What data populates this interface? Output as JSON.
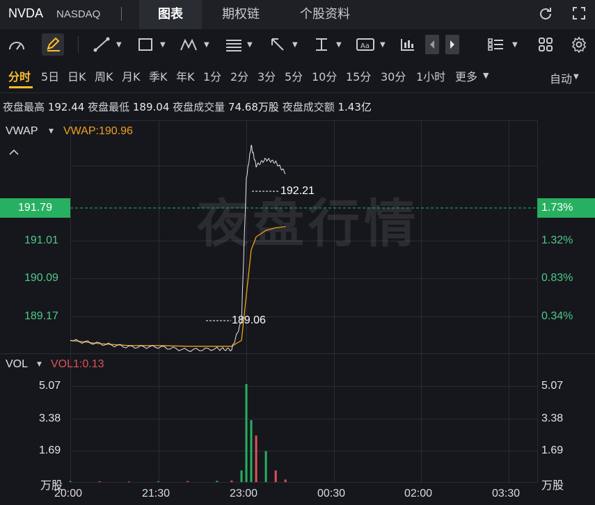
{
  "header": {
    "ticker": "NVDA",
    "exchange": "NASDAQ",
    "tabs": [
      {
        "label": "图表",
        "active": true
      },
      {
        "label": "期权链",
        "active": false
      },
      {
        "label": "个股资料",
        "active": false
      }
    ]
  },
  "toolbar": {
    "icons": [
      "gauge-icon",
      "pen-icon",
      "line-tool-icon",
      "rect-tool-icon",
      "pattern-tool-icon",
      "fib-tool-icon",
      "arrow-tool-icon",
      "measure-tool-icon",
      "text-tool-icon",
      "indicator-icon",
      "prev-icon",
      "next-icon",
      "list-layout-icon",
      "grid-layout-icon",
      "settings-icon"
    ]
  },
  "periods": {
    "items": [
      "分时",
      "5日",
      "日K",
      "周K",
      "月K",
      "季K",
      "年K",
      "1分",
      "2分",
      "3分",
      "5分",
      "10分",
      "15分",
      "30分",
      "1小时",
      "更多"
    ],
    "active": "分时",
    "right": "自动"
  },
  "stats": {
    "high_label": "夜盘最高",
    "high": "192.44",
    "low_label": "夜盘最低",
    "low": "189.04",
    "vol_label": "夜盘成交量",
    "vol": "74.68万股",
    "amt_label": "夜盘成交额",
    "amt": "1.43亿"
  },
  "price_panel": {
    "indicator": "VWAP",
    "indicator_value": "VWAP:190.96",
    "current_price": "191.79",
    "current_pct": "1.73%",
    "y_labels": [
      "191.01",
      "190.09",
      "189.17"
    ],
    "pct_labels": [
      "1.32%",
      "0.83%",
      "0.34%"
    ],
    "high_marker": "192.21",
    "low_marker": "189.06",
    "watermark": "夜盘行情"
  },
  "volume_panel": {
    "indicator": "VOL",
    "indicator_value": "VOL1:0.13",
    "y_labels": [
      "5.07",
      "3.38",
      "1.69"
    ],
    "unit": "万股"
  },
  "x_axis": [
    "20:00",
    "21:30",
    "23:00",
    "00:30",
    "02:00",
    "03:30"
  ],
  "colors": {
    "up": "#27b061",
    "down": "#e0505a",
    "accent": "#ffbe2e",
    "vwap": "#f0a01c"
  },
  "chart_data": {
    "type": "line",
    "x": [
      "20:00",
      "20:30",
      "21:00",
      "21:30",
      "22:00",
      "22:30",
      "22:45",
      "22:55",
      "23:00",
      "23:05",
      "23:10",
      "23:20",
      "23:30",
      "23:40"
    ],
    "series": [
      {
        "name": "price",
        "values": [
          189.2,
          189.15,
          189.1,
          189.1,
          189.05,
          189.07,
          189.06,
          189.5,
          191.7,
          192.21,
          191.9,
          192.0,
          191.95,
          191.79
        ]
      },
      {
        "name": "VWAP",
        "values": [
          189.2,
          189.15,
          189.12,
          189.12,
          189.11,
          189.11,
          189.11,
          189.2,
          189.9,
          190.6,
          190.8,
          190.9,
          190.94,
          190.96
        ]
      }
    ],
    "volume": [
      0.05,
      0.04,
      0.03,
      0.04,
      0.05,
      0.06,
      0.08,
      0.6,
      5.07,
      3.2,
      2.4,
      1.6,
      0.6,
      0.13
    ],
    "ylim": [
      189.0,
      192.6
    ],
    "vol_ylim": [
      0,
      5.5
    ]
  }
}
